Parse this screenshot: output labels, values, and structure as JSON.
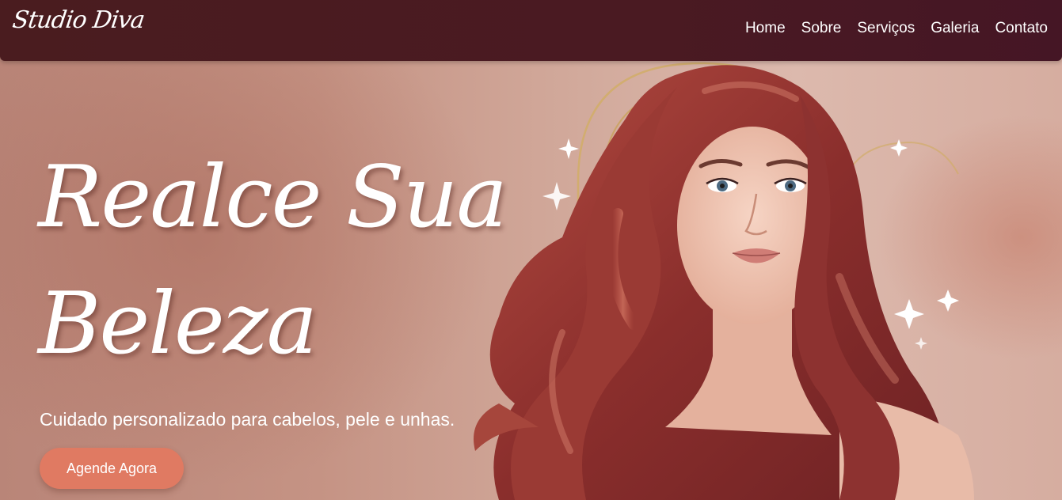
{
  "brand": {
    "logo_text": "Studio Diva"
  },
  "nav": {
    "items": [
      {
        "label": "Home"
      },
      {
        "label": "Sobre"
      },
      {
        "label": "Serviços"
      },
      {
        "label": "Galeria"
      },
      {
        "label": "Contato"
      }
    ]
  },
  "hero": {
    "headline": "Realce Sua Beleza",
    "subtitle": "Cuidado personalizado para cabelos, pele e unhas.",
    "cta_label": "Agende Agora",
    "image_subject": "woman-with-long-red-wavy-hair-portrait"
  },
  "colors": {
    "navbar": "#4a1c1f",
    "cta": "#e07a62",
    "hair": "#9a3a34",
    "arch": "#c9a25a",
    "background": "#c59384"
  }
}
